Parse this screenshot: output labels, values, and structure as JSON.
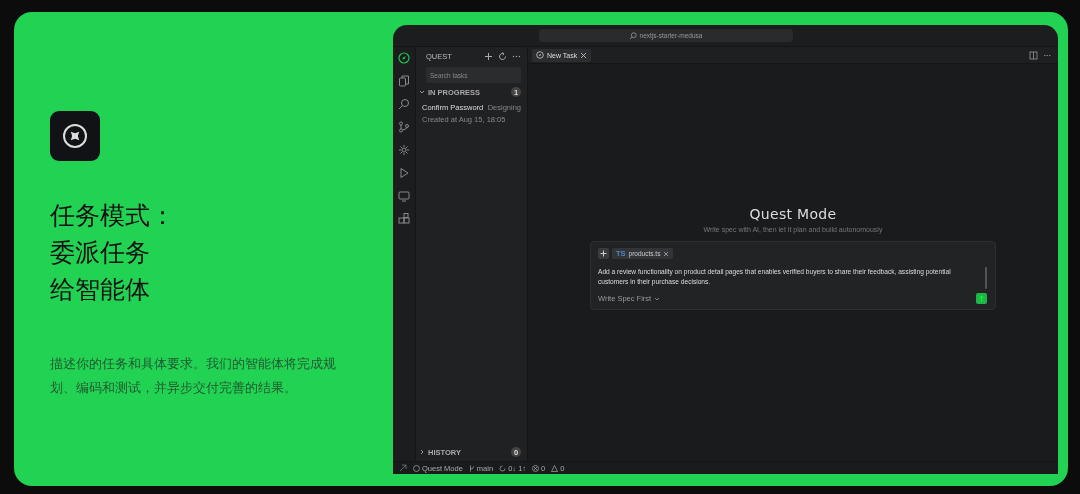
{
  "hero": {
    "title_lines": [
      "任务模式：",
      "委派任务",
      "给智能体"
    ],
    "description": "描述你的任务和具体要求。我们的智能体将完成规划、编码和测试，并异步交付完善的结果。"
  },
  "ide": {
    "title_search": "nextjs-starter-medusa",
    "activity_bar": [
      {
        "selected": true
      },
      {
        "selected": false
      },
      {
        "selected": false
      },
      {
        "selected": false
      },
      {
        "selected": false
      },
      {
        "selected": false
      },
      {
        "selected": false
      },
      {
        "selected": false
      }
    ],
    "sidebar": {
      "title": "QUEST",
      "search_placeholder": "Search tasks",
      "sections": [
        {
          "label": "IN PROGRESS",
          "count": "1",
          "expanded": true,
          "tasks": [
            {
              "name": "Confirm Password",
              "status": "Designing",
              "created": "Created at Aug 15, 18:05"
            }
          ]
        },
        {
          "label": "HISTORY",
          "count": "0",
          "expanded": false
        }
      ]
    },
    "tabs": [
      {
        "label": "New Task",
        "selected": true
      }
    ],
    "main": {
      "title": "Quest Mode",
      "subtitle": "Write spec with AI, then let it plan and build autonomously",
      "composer": {
        "attachment_badge": "TS",
        "attachment": "products.ts",
        "value": "Add a review functionality on product detail pages that enables verified buyers to share their feedback, assisting potential customers in their purchase decisions.",
        "mode": "Write Spec First"
      }
    },
    "status_bar": {
      "mode": "Quest Mode",
      "branch": "main",
      "sync": "0↓ 1↑",
      "errors": "0",
      "warnings": "0"
    }
  }
}
